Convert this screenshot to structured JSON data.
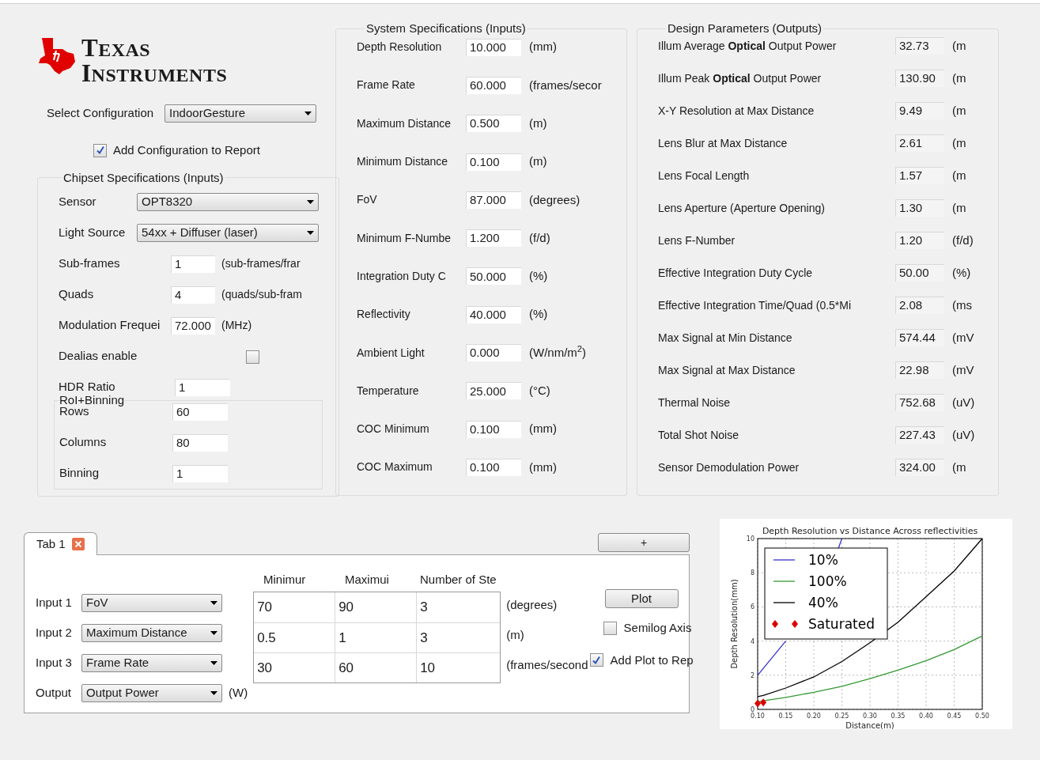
{
  "logo": {
    "line1": "TEXAS",
    "line2": "INSTRUMENTS"
  },
  "configuration": {
    "label": "Select Configuration",
    "value": "IndoorGesture"
  },
  "add_configuration": {
    "label": "Add Configuration to Report",
    "checked": true
  },
  "chipset": {
    "title": "Chipset Specifications (Inputs)",
    "rows": [
      {
        "kind": "select",
        "label": "Sensor",
        "value": "OPT8320"
      },
      {
        "kind": "select",
        "label": "Light Source",
        "value": "54xx + Diffuser (laser)"
      },
      {
        "kind": "input",
        "label": "Sub-frames",
        "value": "1",
        "unit": "(sub-frames/frar"
      },
      {
        "kind": "input",
        "label": "Quads",
        "value": "4",
        "unit": "(quads/sub-fram"
      },
      {
        "kind": "input",
        "label": "Modulation Frequei",
        "value": "72.000",
        "unit": "(MHz)"
      },
      {
        "kind": "checkbox",
        "label": "Dealias enable",
        "checked": false
      },
      {
        "kind": "input",
        "label": "HDR Ratio",
        "value": "1"
      }
    ],
    "roi": {
      "title": "RoI+Binning",
      "rows": [
        {
          "label": "Rows",
          "value": "60"
        },
        {
          "label": "Columns",
          "value": "80"
        },
        {
          "label": "Binning",
          "value": "1"
        }
      ]
    }
  },
  "system": {
    "title": "System Specifications (Inputs)",
    "rows": [
      {
        "label": "Depth Resolution",
        "value": "10.000",
        "unit": "(mm)"
      },
      {
        "label": "Frame Rate",
        "value": "60.000",
        "unit": "(frames/secor"
      },
      {
        "label": "Maximum Distance",
        "value": "0.500",
        "unit": "(m)"
      },
      {
        "label": "Minimum Distance",
        "value": "0.100",
        "unit": "(m)"
      },
      {
        "label": "FoV",
        "value": "87.000",
        "unit": "(degrees)"
      },
      {
        "label": "Minimum F-Numbe",
        "value": "1.200",
        "unit": "(f/d)"
      },
      {
        "label": "Integration Duty C",
        "value": "50.000",
        "unit": "(%)"
      },
      {
        "label": "Reflectivity",
        "value": "40.000",
        "unit": "(%)"
      },
      {
        "label": "Ambient Light",
        "value": "0.000",
        "unit": "(W/nm/m$^{2}$)"
      },
      {
        "label": "Temperature",
        "value": "25.000",
        "unit": "(°C)"
      },
      {
        "label": "COC Minimum",
        "value": "0.100",
        "unit": "(mm)"
      },
      {
        "label": "COC Maximum",
        "value": "0.100",
        "unit": "(mm)"
      }
    ]
  },
  "design": {
    "title": "Design Parameters (Outputs)",
    "rows": [
      {
        "label": "Illum Average **Optical** Output Power",
        "value": "32.73",
        "unit": "(m"
      },
      {
        "label": "Illum Peak **Optical** Output Power",
        "value": "130.90",
        "unit": "(m"
      },
      {
        "label": "X-Y Resolution at Max Distance",
        "value": "9.49",
        "unit": "(m"
      },
      {
        "label": "Lens Blur at Max Distance",
        "value": "2.61",
        "unit": "(m"
      },
      {
        "label": "Lens Focal Length",
        "value": "1.57",
        "unit": "(m"
      },
      {
        "label": "Lens Aperture (Aperture Opening)",
        "value": "1.30",
        "unit": "(m"
      },
      {
        "label": "Lens F-Number",
        "value": "1.20",
        "unit": "(f/d)"
      },
      {
        "label": "Effective Integration Duty Cycle",
        "value": "50.00",
        "unit": "(%)"
      },
      {
        "label": "Effective Integration Time/Quad (0.5*Mi",
        "value": "2.08",
        "unit": "(ms"
      },
      {
        "label": "Max Signal at Min Distance",
        "value": "574.44",
        "unit": "(mV"
      },
      {
        "label": "Max Signal at Max Distance",
        "value": "22.98",
        "unit": "(mV"
      },
      {
        "label": "Thermal Noise",
        "value": "752.68",
        "unit": "(uV)"
      },
      {
        "label": "Total Shot Noise",
        "value": "227.43",
        "unit": "(uV)"
      },
      {
        "label": "Sensor Demodulation Power",
        "value": "324.00",
        "unit": "(m"
      }
    ]
  },
  "sweep": {
    "tabs": [
      {
        "label": "Tab 1",
        "selected": true
      }
    ],
    "add_tab": "+",
    "columns": [
      "Minimur",
      "Maximui",
      "Number of Ste"
    ],
    "inputs": [
      {
        "label": "Input 1",
        "select": "FoV",
        "min": "70",
        "max": "90",
        "steps": "3",
        "unit": "(degrees)"
      },
      {
        "label": "Input 2",
        "select": "Maximum Distance",
        "min": "0.5",
        "max": "1",
        "steps": "3",
        "unit": "(m)"
      },
      {
        "label": "Input 3",
        "select": "Frame Rate",
        "min": "30",
        "max": "60",
        "steps": "10",
        "unit": "(frames/second"
      }
    ],
    "output": {
      "label": "Output",
      "select": "Output Power",
      "unit": "(W)"
    },
    "plot_button": "Plot",
    "semilog": {
      "label": "Semilog Axis",
      "checked": false
    },
    "add_plot": {
      "label": "Add Plot to Rep",
      "checked": true
    }
  },
  "plot": {
    "chart_data": {
      "type": "line",
      "title": "Depth Resolution vs Distance Across reflectivities",
      "xlabel": "Distance(m)",
      "ylabel": "Depth Resolution(mm)",
      "x": [
        0.1,
        0.11,
        0.15,
        0.2,
        0.25,
        0.3,
        0.35,
        0.4,
        0.45,
        0.5
      ],
      "series": [
        {
          "name": "10%",
          "color": "#3333cc",
          "type": "line",
          "values": [
            2,
            2.4,
            4,
            null,
            10,
            null,
            null,
            null,
            null,
            null
          ]
        },
        {
          "name": "100%",
          "color": "#339933",
          "type": "line",
          "values": [
            0.45,
            0.5,
            0.7,
            1.0,
            1.35,
            1.8,
            2.3,
            2.85,
            3.5,
            4.3
          ]
        },
        {
          "name": "40%",
          "color": "#000000",
          "type": "line",
          "values": [
            0.75,
            0.82,
            1.25,
            1.9,
            2.8,
            3.9,
            5.1,
            6.6,
            8.1,
            10
          ]
        },
        {
          "name": "Saturated",
          "color": "#dd0000",
          "type": "scatter",
          "values": [
            0.35,
            0.4,
            null,
            null,
            null,
            null,
            null,
            null,
            null,
            null
          ]
        }
      ],
      "xlim": [
        0.1,
        0.5
      ],
      "ylim": [
        0,
        10
      ],
      "grid": true,
      "legend": true,
      "xticks": [
        {
          "value": 0.1,
          "label": "0.10"
        },
        {
          "value": 0.15,
          "label": "0.15"
        },
        {
          "value": 0.2,
          "label": "0.20"
        },
        {
          "value": 0.25,
          "label": "0.25"
        },
        {
          "value": 0.3,
          "label": "0.30"
        },
        {
          "value": 0.35,
          "label": "0.35"
        },
        {
          "value": 0.4,
          "label": "0.40"
        },
        {
          "value": 0.45,
          "label": "0.45"
        },
        {
          "value": 0.5,
          "label": "0.50"
        }
      ],
      "yticks": [
        0,
        2,
        4,
        6,
        8,
        10
      ]
    }
  }
}
